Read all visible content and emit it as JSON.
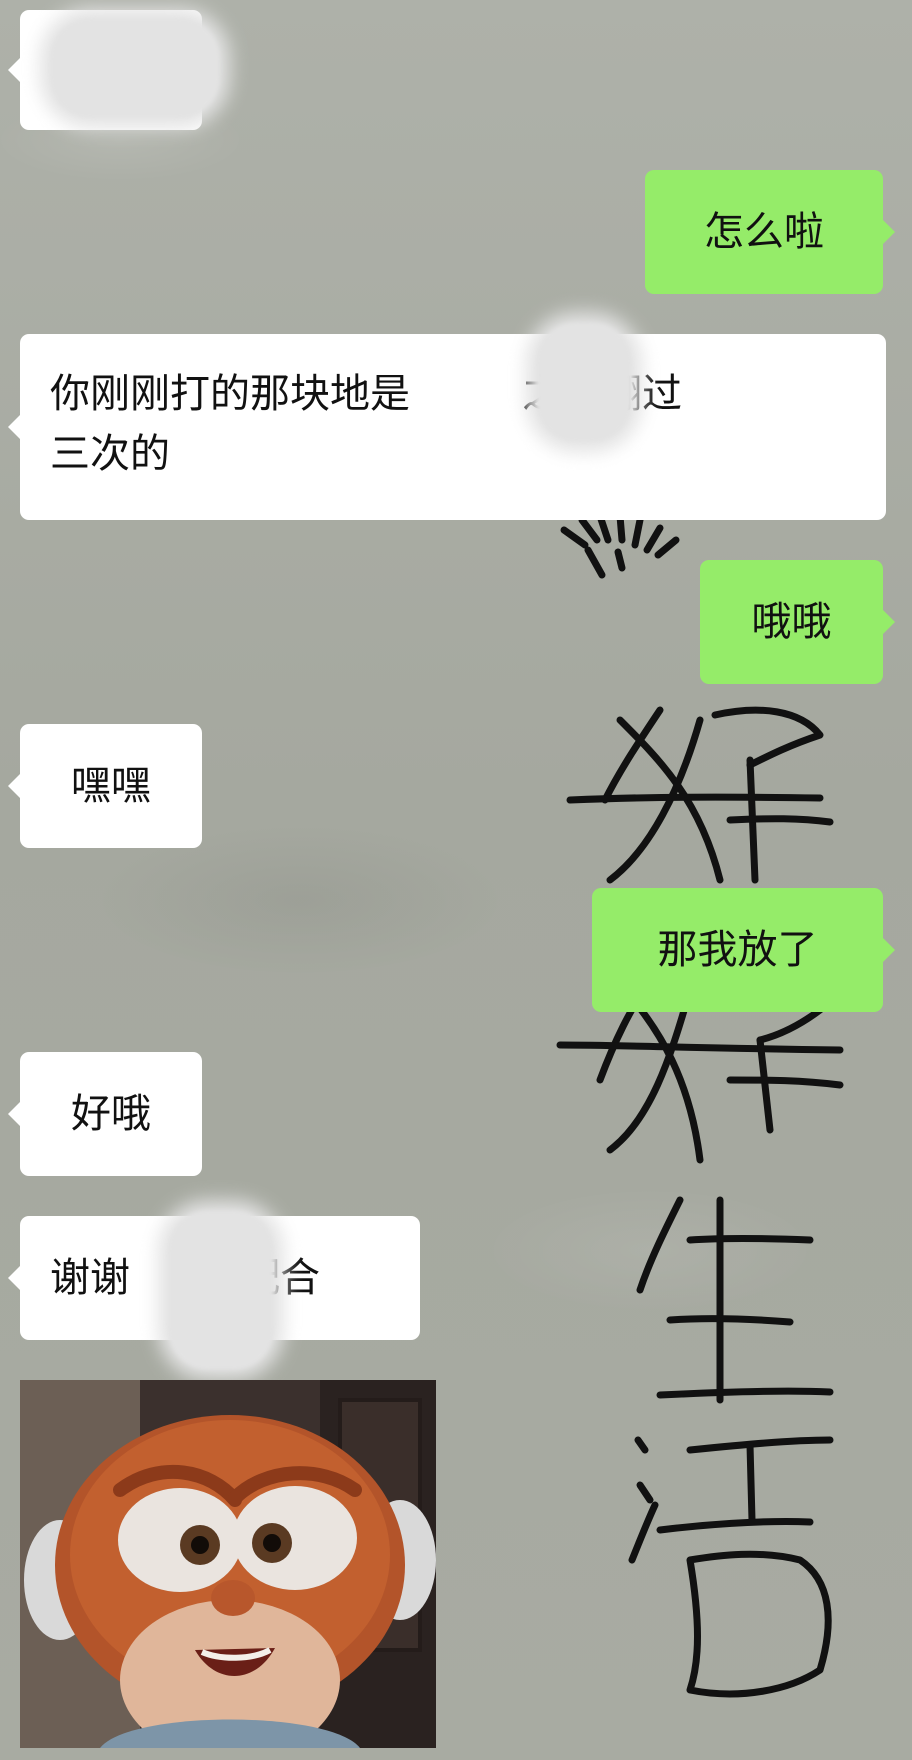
{
  "chat": {
    "messages": [
      {
        "side": "incoming",
        "text": ""
      },
      {
        "side": "outgoing",
        "text": "怎么啦"
      },
      {
        "side": "incoming",
        "line1_a": "你刚刚打的那块地是",
        "line1_b": "之前翻过",
        "line2": "三次的"
      },
      {
        "side": "outgoing",
        "text": "哦哦"
      },
      {
        "side": "incoming",
        "text": "嘿嘿"
      },
      {
        "side": "outgoing",
        "text": "那我放了"
      },
      {
        "side": "incoming",
        "text": "好哦"
      },
      {
        "side": "incoming",
        "text_a": "谢谢",
        "text_b": "配合"
      },
      {
        "side": "incoming",
        "type": "sticker",
        "sticker": "cartoon-character-sticker"
      }
    ]
  },
  "wallpaper": {
    "handwriting": [
      "好",
      "好",
      "生",
      "活"
    ],
    "colors": {
      "background": "#a7aaa1",
      "incoming_bubble": "#ffffff",
      "outgoing_bubble": "#95ec69",
      "ink": "#111111"
    }
  }
}
